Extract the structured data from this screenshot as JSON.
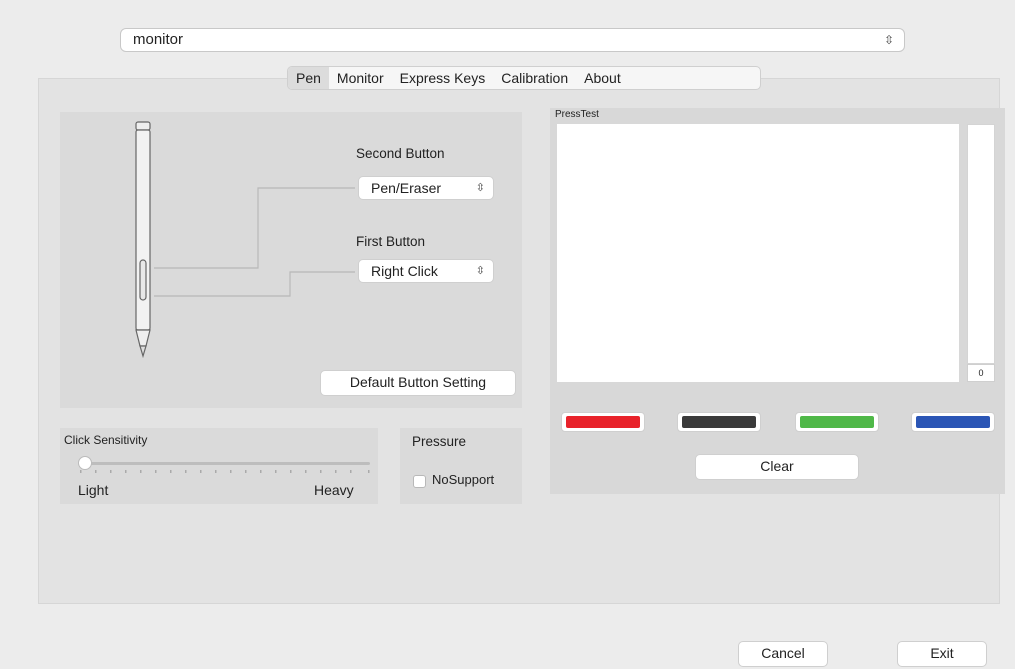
{
  "device": {
    "selected": "monitor"
  },
  "tabs": [
    "Pen",
    "Monitor",
    "Express Keys",
    "Calibration",
    "About"
  ],
  "pen": {
    "second_button_label": "Second Button",
    "second_button_value": "Pen/Eraser",
    "first_button_label": "First Button",
    "first_button_value": "Right Click",
    "default_button": "Default  Button Setting"
  },
  "sensitivity": {
    "label": "Click Sensitivity",
    "min_label": "Light",
    "max_label": "Heavy",
    "level": 0.0
  },
  "pressure": {
    "label": "Pressure",
    "checkbox_label": "NoSupport",
    "checked": false
  },
  "presstest": {
    "label": "PressTest",
    "value": "0",
    "colors": [
      "#e8222a",
      "#3a3a3a",
      "#4fb848",
      "#2a55b5"
    ],
    "clear_label": "Clear"
  },
  "footer": {
    "cancel_label": "Cancel",
    "exit_label": "Exit"
  }
}
